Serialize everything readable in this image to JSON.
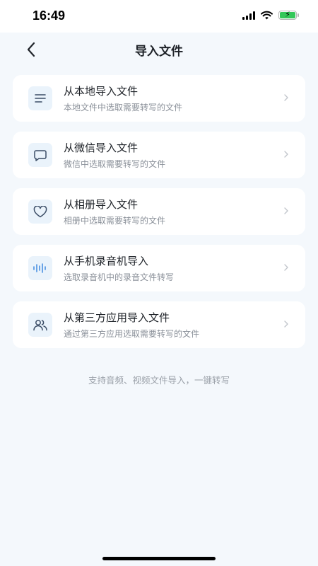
{
  "status_bar": {
    "time": "16:49"
  },
  "header": {
    "title": "导入文件"
  },
  "items": [
    {
      "title": "从本地导入文件",
      "subtitle": "本地文件中选取需要转写的文件",
      "icon": "list-icon"
    },
    {
      "title": "从微信导入文件",
      "subtitle": "微信中选取需要转写的文件",
      "icon": "chat-bubble-icon"
    },
    {
      "title": "从相册导入文件",
      "subtitle": "相册中选取需要转写的文件",
      "icon": "heart-icon"
    },
    {
      "title": "从手机录音机导入",
      "subtitle": "选取录音机中的录音文件转写",
      "icon": "waveform-icon"
    },
    {
      "title": "从第三方应用导入文件",
      "subtitle": "通过第三方应用选取需要转写的文件",
      "icon": "users-icon"
    }
  ],
  "footer": {
    "hint": "支持音频、视频文件导入，一键转写"
  },
  "colors": {
    "background": "#f4f8fc",
    "card": "#ffffff",
    "icon_bg": "#eaf3fb",
    "icon_stroke": "#3b4d66",
    "accent_blue": "#4a90e2",
    "battery_green": "#34c759"
  }
}
